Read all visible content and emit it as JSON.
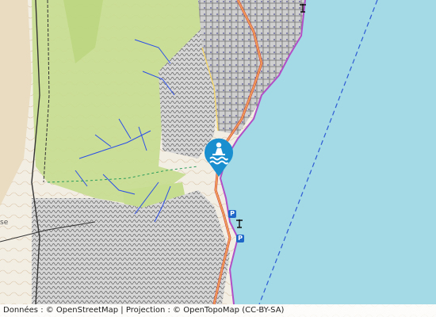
{
  "map": {
    "sea_color": "#a3dae6",
    "land_color": "#f3eee4",
    "forest_color": "#c6dc8e",
    "urban_color": "#c9c9c9",
    "contour_color": "#b5905d",
    "stream_color": "#2a4ee8",
    "road_color": "#f0a65a",
    "coast_outline_color": "#b14fc6",
    "shipping_lane_color": "#2f5bd4"
  },
  "marker": {
    "icon": "swimming-icon",
    "color": "#1a8fd0"
  },
  "side_label": "se",
  "parking_badge": "P",
  "attribution": {
    "data_prefix": "Données : © ",
    "osm_link": "OpenStreetMap",
    "separator": " | Projection : © ",
    "otm_link": "OpenTopoMap",
    "license": " (CC-BY-SA)"
  }
}
